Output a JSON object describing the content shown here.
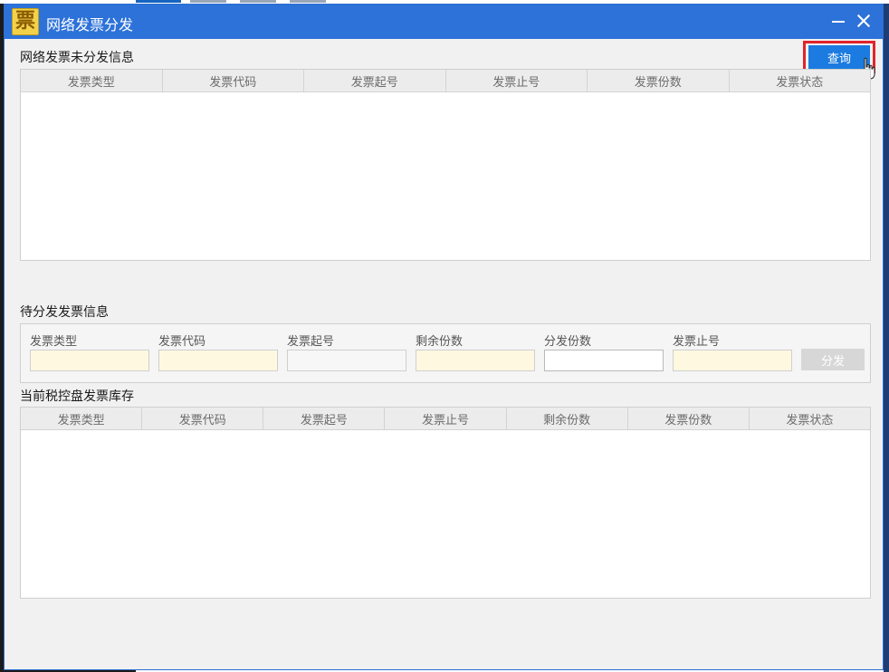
{
  "window": {
    "icon_glyph": "票",
    "title": "网络发票分发"
  },
  "unissued": {
    "label": "网络发票未分发信息",
    "query_label": "查询",
    "columns": [
      "发票类型",
      "发票代码",
      "发票起号",
      "发票止号",
      "发票份数",
      "发票状态"
    ]
  },
  "pending": {
    "label": "待分发发票信息",
    "fields": [
      {
        "label": "发票类型",
        "value": ""
      },
      {
        "label": "发票代码",
        "value": ""
      },
      {
        "label": "发票起号",
        "value": ""
      },
      {
        "label": "剩余份数",
        "value": ""
      },
      {
        "label": "分发份数",
        "value": ""
      },
      {
        "label": "发票止号",
        "value": ""
      }
    ],
    "distribute_label": "分发"
  },
  "inventory": {
    "label": "当前税控盘发票库存",
    "columns": [
      "发票类型",
      "发票代码",
      "发票起号",
      "发票止号",
      "剩余份数",
      "发票份数",
      "发票状态"
    ]
  },
  "colors": {
    "titlebar": "#2d72d9",
    "accent_button": "#1b7be0",
    "highlight_box": "#e0242b",
    "readonly_field": "#fff8e1"
  }
}
